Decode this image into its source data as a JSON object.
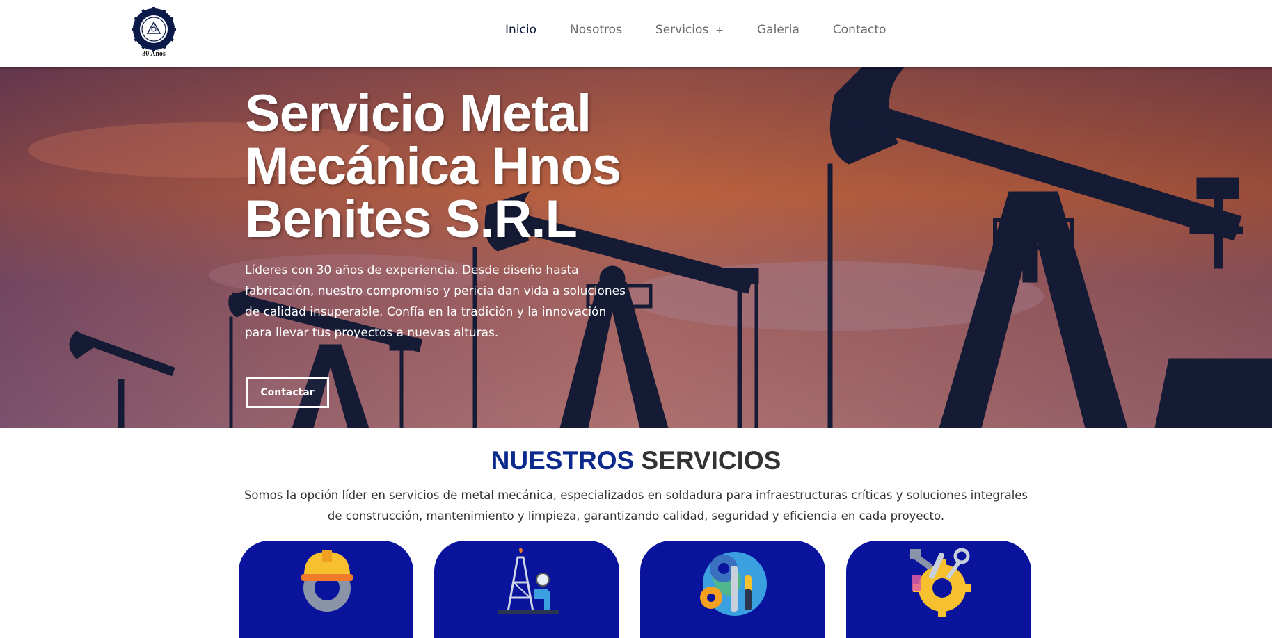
{
  "logo": {
    "caption": "30 Años"
  },
  "nav": {
    "items": [
      {
        "label": "Inicio",
        "active": true
      },
      {
        "label": "Nosotros",
        "active": false
      },
      {
        "label": "Servicios",
        "active": false
      },
      {
        "label": "Galeria",
        "active": false
      },
      {
        "label": "Contacto",
        "active": false
      }
    ],
    "servicios_plus": "+"
  },
  "hero": {
    "title": "Servicio Metal Mecánica Hnos Benites S.R.L",
    "description": "Líderes con 30 años de experiencia. Desde diseño hasta fabricación, nuestro compromiso y pericia dan vida a soluciones de calidad insuperable. Confía en la tradición y la innovación para llevar tus proyectos a nuevas alturas.",
    "button_label": "Contactar"
  },
  "services": {
    "heading_part1": "NUESTROS",
    "heading_part2": "SERVICIOS",
    "description": "Somos la opción líder en servicios de metal mecánica, especializados en soldadura para infraestructuras críticas y soluciones integrales de construcción, mantenimiento y limpieza, garantizando calidad, seguridad y eficiencia en cada proyecto.",
    "cards": [
      {
        "icon": "hardhat-gear-icon"
      },
      {
        "icon": "oil-rig-icon"
      },
      {
        "icon": "tools-globe-icon"
      },
      {
        "icon": "tools-gear-icon"
      }
    ]
  },
  "colors": {
    "accent_blue": "#0b2a8c",
    "card_blue": "#0a139c",
    "nav_active": "#0a1a3a"
  }
}
